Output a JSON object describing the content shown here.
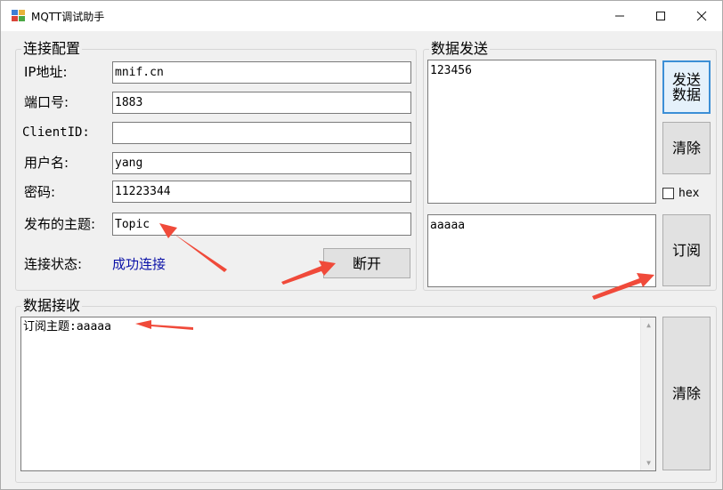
{
  "window": {
    "title": "MQTT调试助手",
    "controls": {
      "minimize": "—",
      "maximize": "☐",
      "close": "✕"
    }
  },
  "connection": {
    "group_title": "连接配置",
    "ip_label": "IP地址:",
    "ip_value": "mnif.cn",
    "port_label": "端口号:",
    "port_value": "1883",
    "clientid_label": "ClientID:",
    "clientid_value": "",
    "username_label": "用户名:",
    "username_value": "yang",
    "password_label": "密码:",
    "password_value": "11223344",
    "topic_label": "发布的主题:",
    "topic_value": "Topic",
    "status_label": "连接状态:",
    "status_value": "成功连接",
    "disconnect_button": "断开"
  },
  "send": {
    "group_title": "数据发送",
    "send_text": "123456",
    "send_button": "发送\n数据",
    "clear_button": "清除",
    "hex_label": "hex",
    "hex_checked": false,
    "subscribe_topic": "aaaaa",
    "subscribe_button": "订阅"
  },
  "receive": {
    "group_title": "数据接收",
    "text": "订阅主题:aaaaa",
    "clear_button": "清除"
  },
  "colors": {
    "status_text": "#0b12a8",
    "annotation_arrow": "#f04a3a",
    "focus_border": "#3c8fd6"
  }
}
